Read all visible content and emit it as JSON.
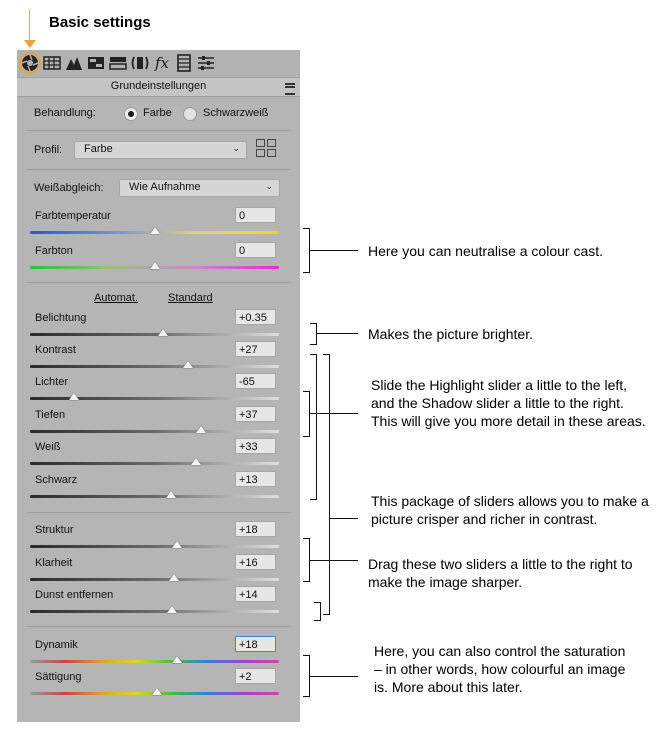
{
  "heading": "Basic settings",
  "toolbar": {
    "icons": [
      "aperture-icon",
      "grid-icon",
      "mountain-icon",
      "tone-icon",
      "split-icon",
      "lens-icon",
      "fx-icon",
      "film-icon",
      "sliders-icon"
    ],
    "fx_label": "fx"
  },
  "panel": {
    "title": "Grundeinstellungen",
    "treatment": {
      "label": "Behandlung:",
      "option_color": "Farbe",
      "option_bw": "Schwarzweiß",
      "selected": "Farbe"
    },
    "profile": {
      "label": "Profil:",
      "value": "Farbe"
    },
    "white_balance": {
      "label": "Weißabgleich:",
      "value": "Wie Aufnahme"
    },
    "links": {
      "auto": "Automat.",
      "default": "Standard"
    },
    "sliders": [
      {
        "name": "temperature",
        "label": "Farbtemperatur",
        "value": "0",
        "pos": 0.5,
        "track": "temp"
      },
      {
        "name": "tint",
        "label": "Farbton",
        "value": "0",
        "pos": 0.5,
        "track": "tint"
      },
      {
        "name": "exposure",
        "label": "Belichtung",
        "value": "+0.35",
        "pos": 0.535,
        "track": "gray"
      },
      {
        "name": "contrast",
        "label": "Kontrast",
        "value": "+27",
        "pos": 0.635,
        "track": "gray"
      },
      {
        "name": "highlights",
        "label": "Lichter",
        "value": "-65",
        "pos": 0.175,
        "track": "gray"
      },
      {
        "name": "shadows",
        "label": "Tiefen",
        "value": "+37",
        "pos": 0.685,
        "track": "gray"
      },
      {
        "name": "whites",
        "label": "Weiß",
        "value": "+33",
        "pos": 0.665,
        "track": "gray"
      },
      {
        "name": "blacks",
        "label": "Schwarz",
        "value": "+13",
        "pos": 0.565,
        "track": "gray"
      },
      {
        "name": "texture",
        "label": "Struktur",
        "value": "+18",
        "pos": 0.59,
        "track": "gray"
      },
      {
        "name": "clarity",
        "label": "Klarheit",
        "value": "+16",
        "pos": 0.58,
        "track": "gray"
      },
      {
        "name": "dehaze",
        "label": "Dunst entfernen",
        "value": "+14",
        "pos": 0.57,
        "track": "gray"
      },
      {
        "name": "vibrance",
        "label": "Dynamik",
        "value": "+18",
        "pos": 0.59,
        "track": "rainbow"
      },
      {
        "name": "saturation",
        "label": "Sättigung",
        "value": "+2",
        "pos": 0.51,
        "track": "rainbow"
      }
    ]
  },
  "notes": {
    "cast": "Here you can neutralise a colour cast.",
    "brighter": "Makes the picture brighter.",
    "highlight_shadow": "Slide the Highlight slider a little to the left, and the Shadow slider a little to the right. This will give you more detail in these areas.",
    "package": "This package of sliders allows you to make a picture crisper and richer in contrast.",
    "sharper": "Drag these two sliders a little to the right to make the image sharper.",
    "saturation": "Here, you can also control the saturation – in other words, how colourful an image is. More about this later."
  },
  "colors": {
    "accent": "#e8a43a",
    "panel": "#b5b5b5",
    "focus": "#3e86d6"
  }
}
